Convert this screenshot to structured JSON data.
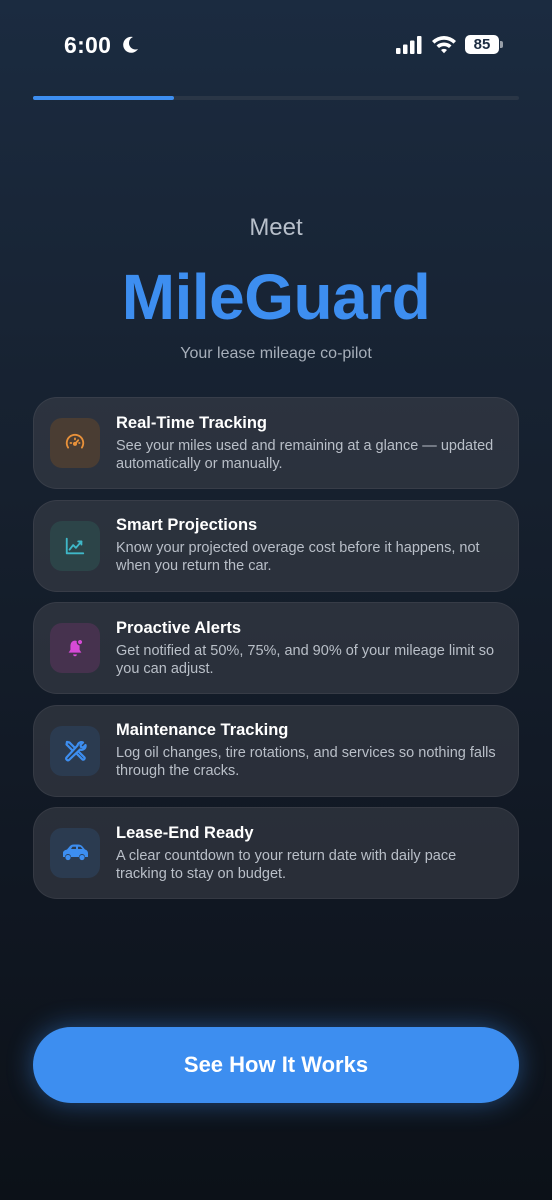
{
  "status_bar": {
    "time": "6:00",
    "battery": "85",
    "icons": [
      "moon-icon",
      "signal-icon",
      "wifi-icon",
      "battery-icon"
    ]
  },
  "progress": {
    "fraction": 0.29,
    "color": "#3d8ef0"
  },
  "header": {
    "meet": "Meet",
    "app_name": "MileGuard",
    "tagline": "Your lease mileage co-pilot"
  },
  "features": [
    {
      "icon": "speedometer-icon",
      "icon_color": "#e8913a",
      "icon_bg": "#4a3d33",
      "title": "Real-Time Tracking",
      "desc": "See your miles used and remaining at a glance — updated automatically or manually."
    },
    {
      "icon": "trend-chart-icon",
      "icon_color": "#3fb8c8",
      "icon_bg": "#2c4448",
      "title": "Smart Projections",
      "desc": "Know your projected overage cost before it happens, not when you return the car."
    },
    {
      "icon": "bell-icon",
      "icon_color": "#d64ad6",
      "icon_bg": "#46324e",
      "title": "Proactive Alerts",
      "desc": "Get notified at 50%, 75%, and 90% of your mileage limit so you can adjust."
    },
    {
      "icon": "wrench-screwdriver-icon",
      "icon_color": "#3d8ef0",
      "icon_bg": "#2b3b50",
      "title": "Maintenance Tracking",
      "desc": "Log oil changes, tire rotations, and services so nothing falls through the cracks."
    },
    {
      "icon": "car-icon",
      "icon_color": "#3d8ef0",
      "icon_bg": "#2b3b50",
      "title": "Lease-End Ready",
      "desc": "A clear countdown to your return date with daily pace tracking to stay on budget."
    }
  ],
  "cta": {
    "label": "See How It Works"
  }
}
